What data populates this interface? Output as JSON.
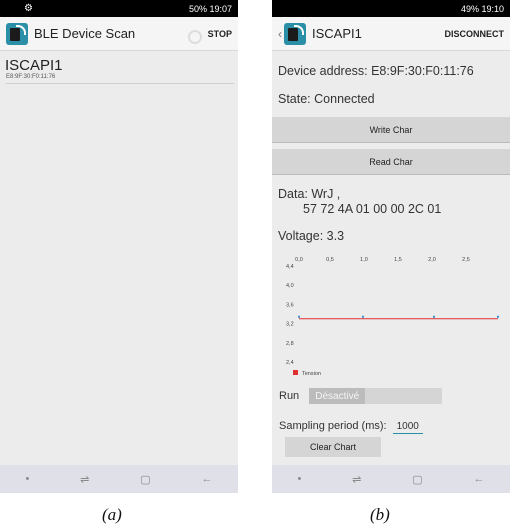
{
  "screenA": {
    "status": {
      "text": "50% 19:07"
    },
    "appbar": {
      "title": "BLE Device Scan",
      "stop": "STOP"
    },
    "device": {
      "name": "ISCAPI1",
      "address": "E8:9F:30:F0:11:76"
    }
  },
  "screenB": {
    "status": {
      "text": "49% 19:10"
    },
    "appbar": {
      "title": "ISCAPI1",
      "disconnect": "DISCONNECT"
    },
    "address_line": "Device address: E8:9F:30:F0:11:76",
    "state_line": "State: Connected",
    "write_button": "Write Char",
    "read_button": "Read Char",
    "data_line1": "Data: WrJ ,",
    "data_line2": "57 72 4A 01 00 00 2C 01",
    "voltage_line": "Voltage: 3.3",
    "run_label": "Run",
    "toggle_label": "Désactivé",
    "sampling_label": "Sampling period (ms):",
    "sampling_value": "1000",
    "clear_button": "Clear Chart"
  },
  "chart_data": {
    "type": "line",
    "x_ticks": [
      "0,0",
      "0,5",
      "1,0",
      "1,5",
      "2,0",
      "2,5"
    ],
    "y_ticks": [
      "4,4",
      "4,0",
      "3,6",
      "3,2",
      "2,8",
      "2,4"
    ],
    "ylim": [
      2.4,
      4.4
    ],
    "xlim": [
      0,
      2.8
    ],
    "series": [
      {
        "name": "Tension",
        "color": "#e03030",
        "x": [
          0.0,
          0.9,
          1.9,
          2.8
        ],
        "values": [
          3.3,
          3.3,
          3.3,
          3.3
        ]
      }
    ]
  },
  "captions": {
    "a": "(a)",
    "b": "(b)"
  }
}
